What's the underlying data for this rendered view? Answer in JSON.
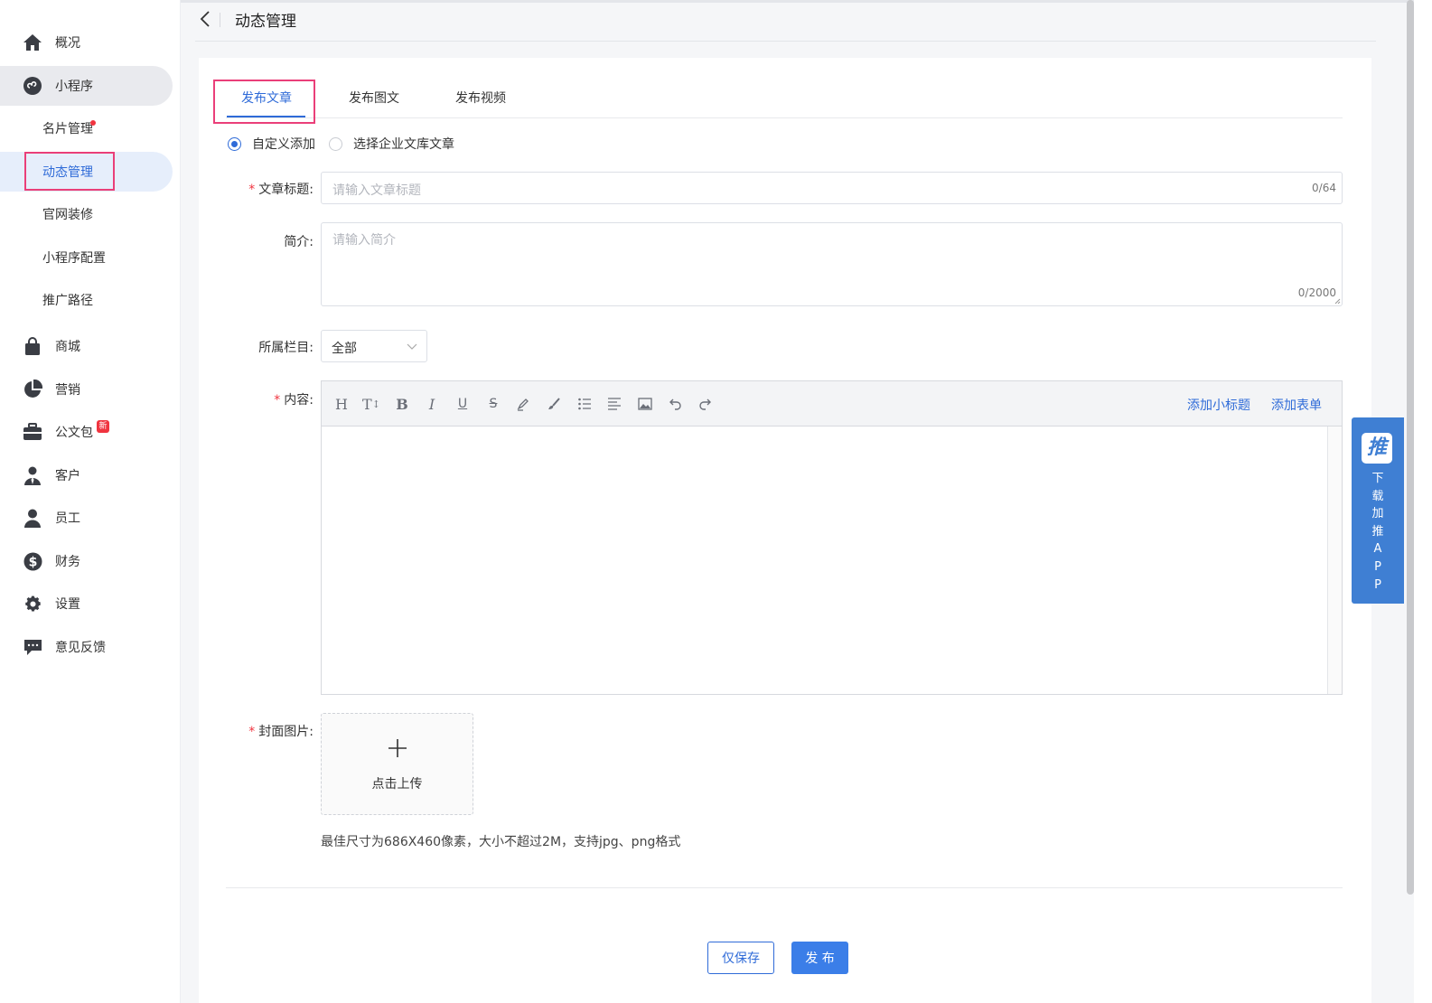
{
  "header": {
    "title": "动态管理"
  },
  "sidebar": {
    "items": [
      {
        "label": "概况",
        "icon": "home-icon"
      },
      {
        "label": "小程序",
        "icon": "mini-program-icon"
      },
      {
        "label": "商城",
        "icon": "shopping-bag-icon"
      },
      {
        "label": "营销",
        "icon": "pie-chart-icon"
      },
      {
        "label": "公文包",
        "icon": "briefcase-icon",
        "badge": "新"
      },
      {
        "label": "客户",
        "icon": "customer-icon"
      },
      {
        "label": "员工",
        "icon": "user-icon"
      },
      {
        "label": "财务",
        "icon": "dollar-icon"
      },
      {
        "label": "设置",
        "icon": "gear-icon"
      },
      {
        "label": "意见反馈",
        "icon": "feedback-icon"
      }
    ],
    "sub_items": [
      {
        "label": "名片管理"
      },
      {
        "label": "动态管理"
      },
      {
        "label": "官网装修"
      },
      {
        "label": "小程序配置"
      },
      {
        "label": "推广路径"
      }
    ],
    "accent_color": "#2f6bd8"
  },
  "tabs": [
    {
      "label": "发布文章"
    },
    {
      "label": "发布图文"
    },
    {
      "label": "发布视频"
    }
  ],
  "radios": [
    {
      "label": "自定义添加",
      "checked": true
    },
    {
      "label": "选择企业文库文章",
      "checked": false
    }
  ],
  "form": {
    "title_label": "文章标题:",
    "title_placeholder": "请输入文章标题",
    "title_count": "0/64",
    "summary_label": "简介:",
    "summary_placeholder": "请输入简介",
    "summary_count": "0/2000",
    "column_label": "所属栏目:",
    "column_value": "全部",
    "content_label": "内容:",
    "cover_label": "封面图片:",
    "upload_text": "点击上传",
    "cover_hint": "最佳尺寸为686X460像素，大小不超过2M，支持jpg、png格式",
    "required_mark": "*"
  },
  "editor": {
    "tools": [
      "heading-icon",
      "text-size-icon",
      "bold-icon",
      "italic-icon",
      "underline-icon",
      "strikethrough-icon",
      "highlighter-icon",
      "brush-icon",
      "list-icon",
      "align-icon",
      "image-icon",
      "undo-icon",
      "redo-icon"
    ],
    "add_subtitle": "添加小标题",
    "add_form": "添加表单"
  },
  "actions": {
    "save_only": "仅保存",
    "publish": "发 布"
  },
  "app_float": {
    "logo": "推",
    "text": "下载加推APP"
  }
}
